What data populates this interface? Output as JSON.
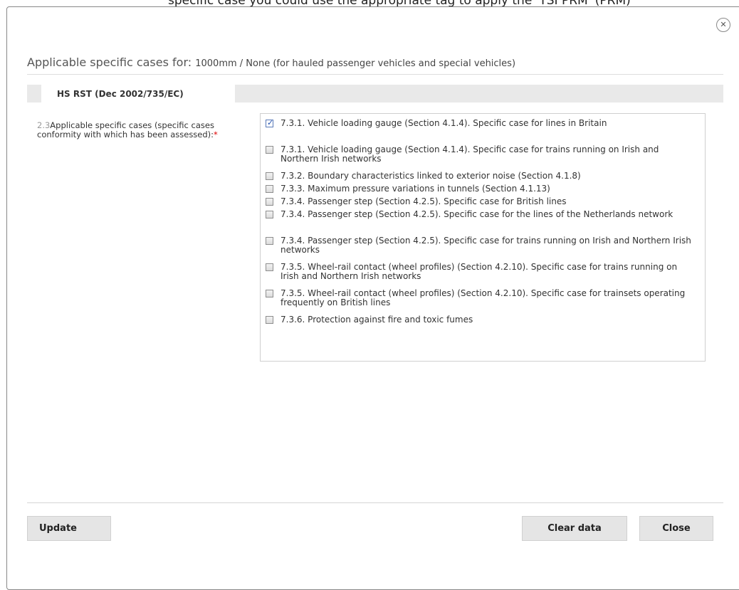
{
  "top_fragment": "specific case you could use the appropriate tag to apply the 'TSI PRM' (PRM)",
  "dialog": {
    "close_icon": "✕",
    "title_label": "Applicable specific cases for:",
    "title_value": "1000mm / None (for hauled passenger vehicles and special vehicles)"
  },
  "section": {
    "tab_label": "HS RST (Dec 2002/735/EC)"
  },
  "field": {
    "number": "2.3",
    "label": "Applicable specific cases (specific cases conformity with which has been assessed):",
    "required_marker": "*"
  },
  "options": [
    {
      "text": "7.3.1. Vehicle loading gauge (Section 4.1.4). Specific case for lines in Britain",
      "checked": true
    },
    {
      "text": "7.3.1. Vehicle loading gauge (Section 4.1.4). Specific case for trains running on Irish and Northern Irish networks",
      "checked": false
    },
    {
      "text": "7.3.2. Boundary characteristics linked to exterior noise (Section 4.1.8)",
      "checked": false
    },
    {
      "text": "7.3.3. Maximum pressure variations in tunnels (Section 4.1.13)",
      "checked": false
    },
    {
      "text": "7.3.4. Passenger step (Section 4.2.5). Specific case for British lines",
      "checked": false
    },
    {
      "text": "7.3.4. Passenger step (Section 4.2.5). Specific case for the lines of the Netherlands network",
      "checked": false
    },
    {
      "text": "7.3.4. Passenger step (Section 4.2.5). Specific case for trains running on Irish and Northern Irish networks",
      "checked": false
    },
    {
      "text": "7.3.5. Wheel-rail contact (wheel profiles) (Section 4.2.10). Specific case for trains running on Irish and Northern Irish networks",
      "checked": false
    },
    {
      "text": "7.3.5. Wheel-rail contact (wheel profiles) (Section 4.2.10). Specific case for trainsets operating frequently on British lines",
      "checked": false
    },
    {
      "text": "7.3.6. Protection against fire and toxic fumes",
      "checked": false
    }
  ],
  "buttons": {
    "update": "Update",
    "clear": "Clear data",
    "close": "Close"
  }
}
